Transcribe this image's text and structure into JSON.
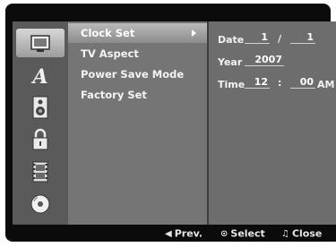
{
  "icons": [
    {
      "name": "disc-setup-icon",
      "active": true
    },
    {
      "name": "language-a-icon",
      "active": false
    },
    {
      "name": "speaker-icon",
      "active": false
    },
    {
      "name": "lock-icon",
      "active": false
    },
    {
      "name": "film-strip-icon",
      "active": false
    },
    {
      "name": "disc-icon",
      "active": false
    }
  ],
  "menu": {
    "items": [
      {
        "label": "Clock Set",
        "selected": true
      },
      {
        "label": "TV Aspect",
        "selected": false
      },
      {
        "label": "Power Save Mode",
        "selected": false
      },
      {
        "label": "Factory Set",
        "selected": false
      }
    ]
  },
  "clock": {
    "date_label": "Date",
    "date_month": "1",
    "date_sep": "/",
    "date_day": "1",
    "year_label": "Year",
    "year_value": "2007",
    "time_label": "Time",
    "time_hour": "12",
    "time_sep": ":",
    "time_min": "00",
    "time_ampm": "AM"
  },
  "footer": {
    "prev_glyph": "◀",
    "prev_label": "Prev.",
    "select_glyph": "⊙",
    "select_label": "Select",
    "close_glyph": "♫",
    "close_label": "Close"
  },
  "colors": {
    "panel": "#6f6f6f",
    "highlight": "#b9b9b9",
    "background": "#0b0b0b"
  }
}
